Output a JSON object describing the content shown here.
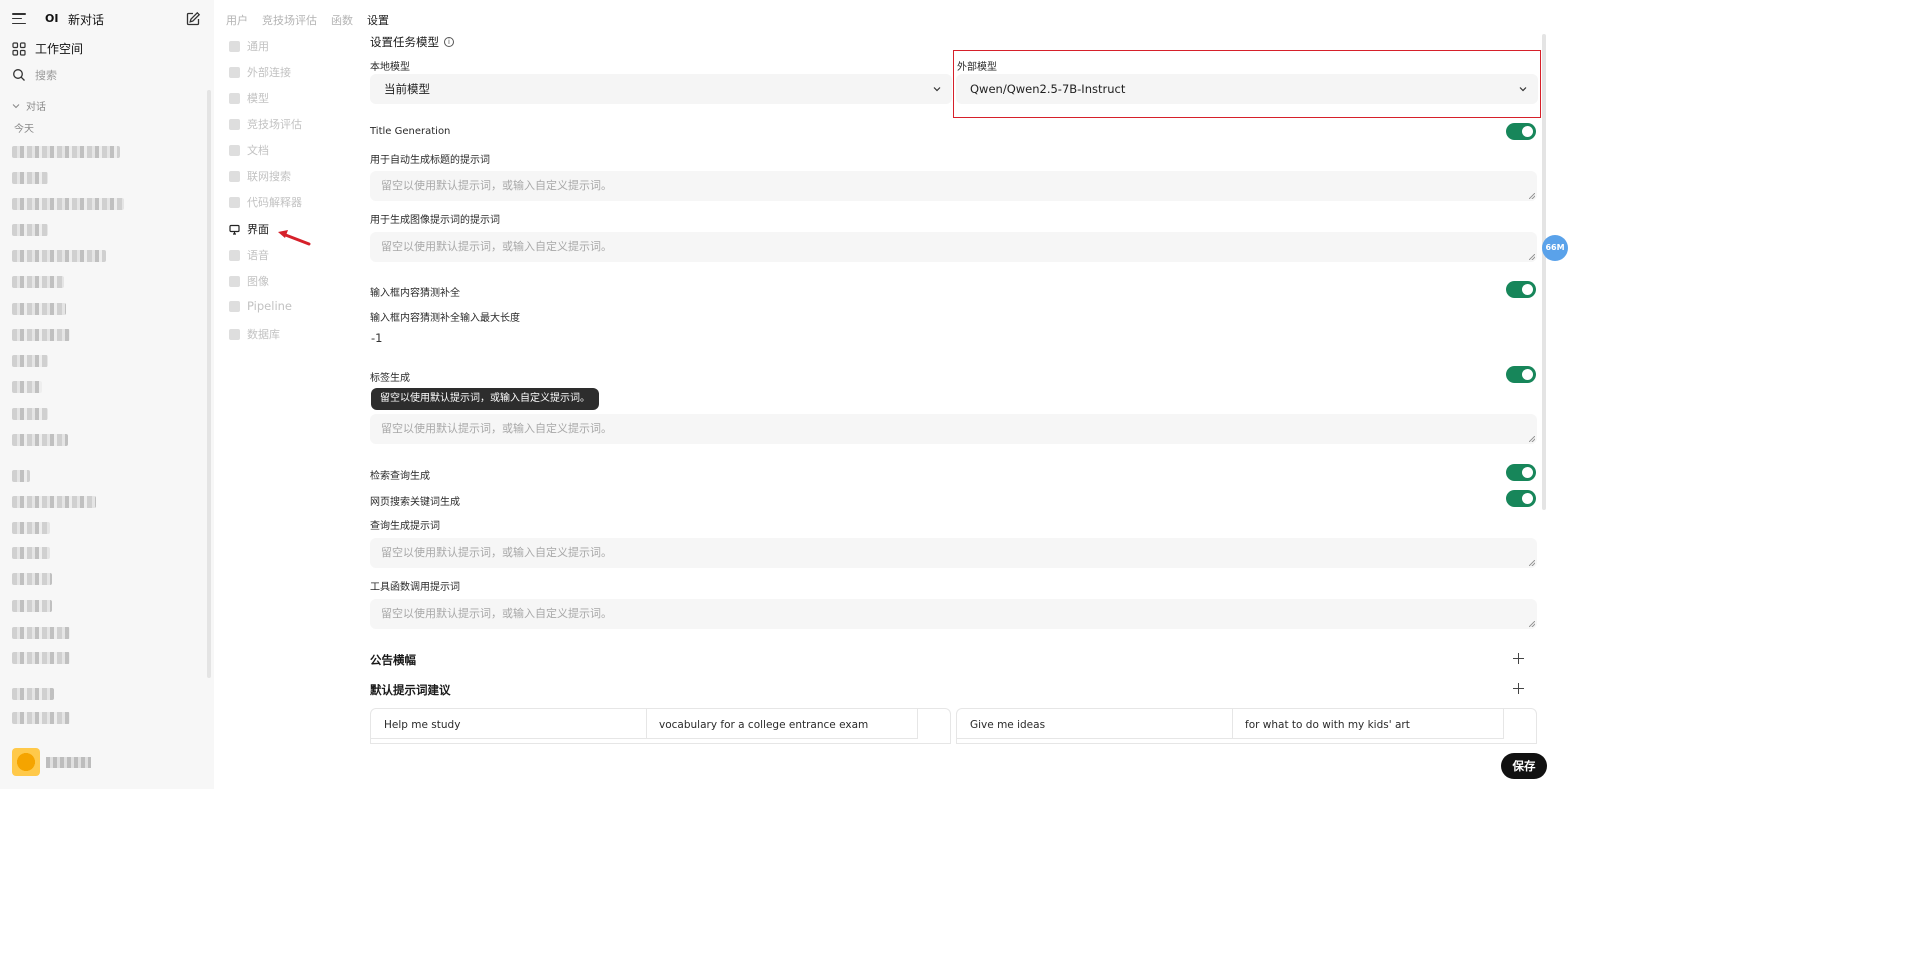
{
  "sidebar": {
    "new_chat_label": "新对话",
    "logo_text": "OI",
    "workspace_label": "工作空间",
    "search_label": "搜索",
    "chats_section_label": "对话",
    "today_label": "今天",
    "chat_items": [
      "",
      "",
      "",
      "",
      "",
      "",
      "",
      "",
      "",
      "",
      "",
      "",
      "",
      "",
      "",
      "",
      "",
      "",
      "",
      "",
      "",
      ""
    ]
  },
  "admin_nav": {
    "tabs": [
      {
        "label": "用户",
        "active": false
      },
      {
        "label": "竞技场评估",
        "active": false
      },
      {
        "label": "函数",
        "active": false
      },
      {
        "label": "设置",
        "active": true
      }
    ]
  },
  "settings_nav": {
    "items": [
      {
        "label": "通用",
        "icon": "gear-icon",
        "active": false
      },
      {
        "label": "外部连接",
        "icon": "cloud-icon",
        "active": false
      },
      {
        "label": "模型",
        "icon": "database-icon",
        "active": false
      },
      {
        "label": "竞技场评估",
        "icon": "document-icon",
        "active": false
      },
      {
        "label": "文档",
        "icon": "file-icon",
        "active": false
      },
      {
        "label": "联网搜索",
        "icon": "globe-icon",
        "active": false
      },
      {
        "label": "代码解释器",
        "icon": "terminal-icon",
        "active": false
      },
      {
        "label": "界面",
        "icon": "monitor-icon",
        "active": true
      },
      {
        "label": "语音",
        "icon": "speaker-icon",
        "active": false
      },
      {
        "label": "图像",
        "icon": "image-icon",
        "active": false
      },
      {
        "label": "Pipeline",
        "icon": "layers-icon",
        "active": false
      },
      {
        "label": "数据库",
        "icon": "database-icon",
        "active": false
      }
    ]
  },
  "task_model": {
    "title": "设置任务模型",
    "info_symbol": "i",
    "local_label": "本地模型",
    "local_value": "当前模型",
    "external_label": "外部模型",
    "external_value": "Qwen/Qwen2.5-7B-Instruct"
  },
  "title_generation": {
    "label": "Title Generation",
    "enabled": true,
    "prompt_label": "用于自动生成标题的提示词",
    "prompt_placeholder": "留空以使用默认提示词，或输入自定义提示词。"
  },
  "image_prompt": {
    "label": "用于生成图像提示词的提示词",
    "placeholder": "留空以使用默认提示词，或输入自定义提示词。"
  },
  "autocomplete": {
    "label": "输入框内容猜测补全",
    "enabled": true,
    "max_length_label": "输入框内容猜测补全输入最大长度",
    "max_length_value": "-1"
  },
  "tags": {
    "label": "标签生成",
    "enabled": true,
    "tooltip": "留空以使用默认提示词，或输入自定义提示词。",
    "placeholder": "留空以使用默认提示词，或输入自定义提示词。"
  },
  "retrieval": {
    "label": "检索查询生成",
    "enabled": true,
    "web_search_label": "网页搜索关键词生成",
    "web_search_enabled": true,
    "query_prompt_label": "查询生成提示词",
    "query_placeholder": "留空以使用默认提示词，或输入自定义提示词。",
    "tools_prompt_label": "工具函数调用提示词",
    "tools_placeholder": "留空以使用默认提示词，或输入自定义提示词。"
  },
  "banners": {
    "label": "公告横幅"
  },
  "suggestions": {
    "label": "默认提示词建议",
    "items": [
      {
        "title": "Help me study",
        "subtitle": "vocabulary for a college entrance exam"
      },
      {
        "title": "Give me ideas",
        "subtitle": "for what to do with my kids' art"
      }
    ]
  },
  "save_label": "保存",
  "memory_badge": "66M",
  "colors": {
    "toggle_on": "#17865a",
    "highlight_frame": "#d6202a",
    "annotation_arrow": "#d6202a",
    "badge": "#5aa2ea"
  }
}
